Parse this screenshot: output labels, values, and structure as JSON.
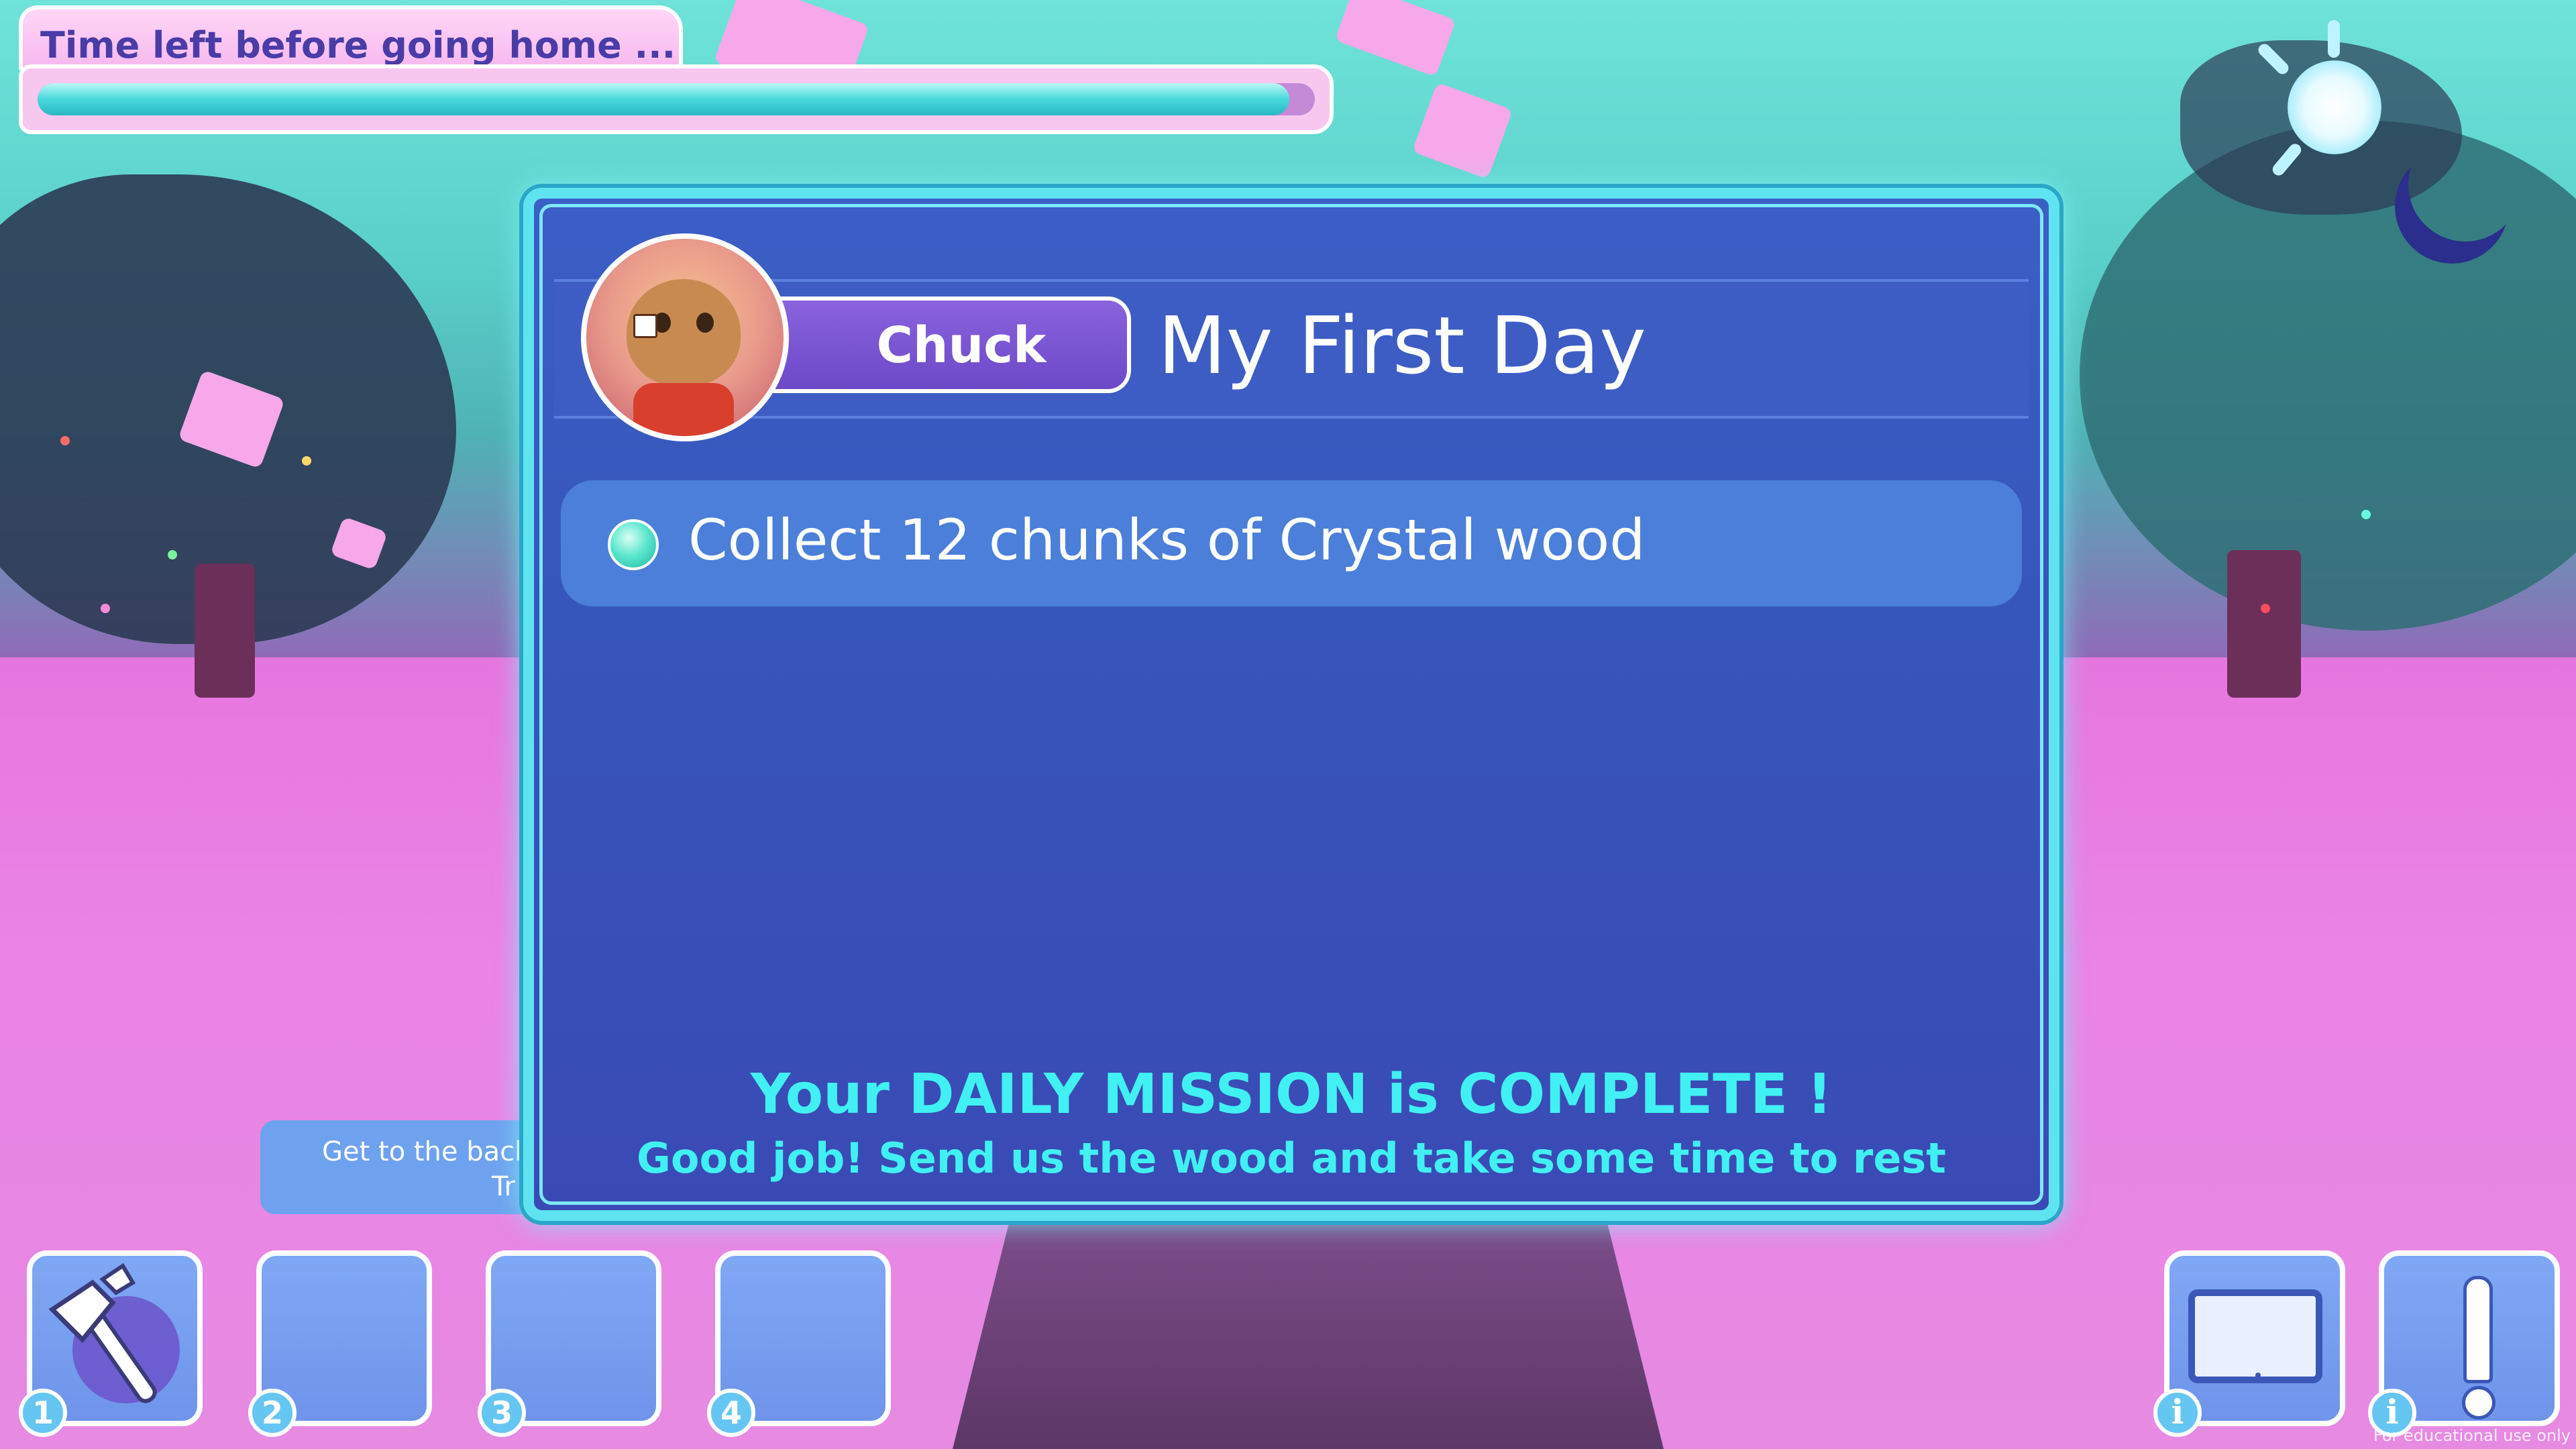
{
  "hud": {
    "timer_label": "Time left before going home ...",
    "timer_progress": 0.98
  },
  "quest": {
    "npc_name": "Chuck",
    "title": "My First Day",
    "tasks": [
      {
        "text": "Collect 12 chunks of Crystal wood",
        "done": true
      }
    ],
    "complete_message": "Your DAILY MISSION is COMPLETE !",
    "subtext": "Good job! Send us the wood and take some time to rest"
  },
  "hint": {
    "line1": "Get to the back",
    "line2": "Tr"
  },
  "hotbar": {
    "slots": [
      {
        "number": "1",
        "item": "axe-icon"
      },
      {
        "number": "2",
        "item": ""
      },
      {
        "number": "3",
        "item": ""
      },
      {
        "number": "4",
        "item": ""
      }
    ]
  },
  "side_buttons": {
    "tablet_badge": "i",
    "alert_badge": "i"
  },
  "footer_note": "For educational use only",
  "colors": {
    "accent_cyan": "#41f0f2",
    "panel_blue": "#3a5fc6",
    "name_plate": "#7a56d4"
  }
}
